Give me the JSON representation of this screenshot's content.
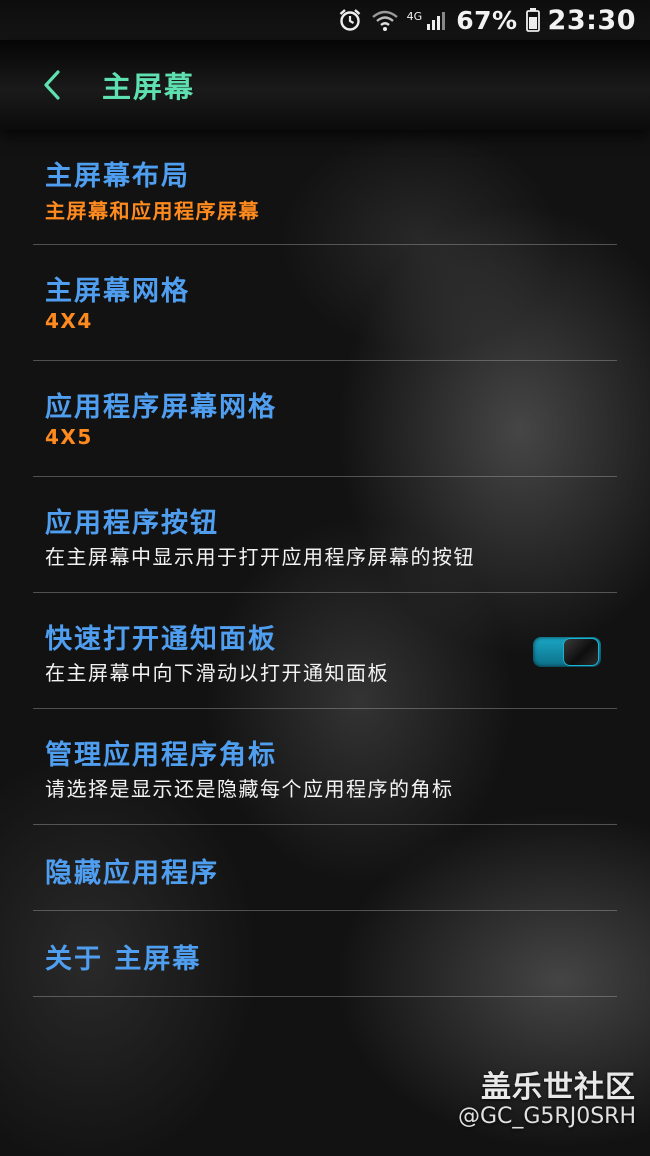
{
  "status_bar": {
    "network_label": "4G",
    "battery_percent": "67%",
    "time": "23:30",
    "icons": [
      "alarm-icon",
      "wifi-icon",
      "signal-icon",
      "battery-icon"
    ]
  },
  "header": {
    "back_icon": "chevron-left-icon",
    "title": "主屏幕"
  },
  "settings": {
    "items": [
      {
        "title": "主屏幕布局",
        "subtitle": "主屏幕和应用程序屏幕"
      },
      {
        "title": "主屏幕网格",
        "subtitle": "4X4"
      },
      {
        "title": "应用程序屏幕网格",
        "subtitle": "4X5"
      },
      {
        "title": "应用程序按钮",
        "subtitle": "在主屏幕中显示用于打开应用程序屏幕的按钮"
      },
      {
        "title": "快速打开通知面板",
        "subtitle": "在主屏幕中向下滑动以打开通知面板",
        "toggle_on": true
      },
      {
        "title": "管理应用程序角标",
        "subtitle": "请选择是显示还是隐藏每个应用程序的角标"
      },
      {
        "title": "隐藏应用程序"
      },
      {
        "title": "关于 主屏幕"
      }
    ]
  },
  "watermark": {
    "brand": "盖乐世社区",
    "user": "@GC_G5RJ0SRH"
  },
  "colors": {
    "title_green": "#5fe0b0",
    "item_blue": "#4f9ef0",
    "value_orange": "#ff8a1e",
    "toggle_teal": "#1aa7c6"
  }
}
